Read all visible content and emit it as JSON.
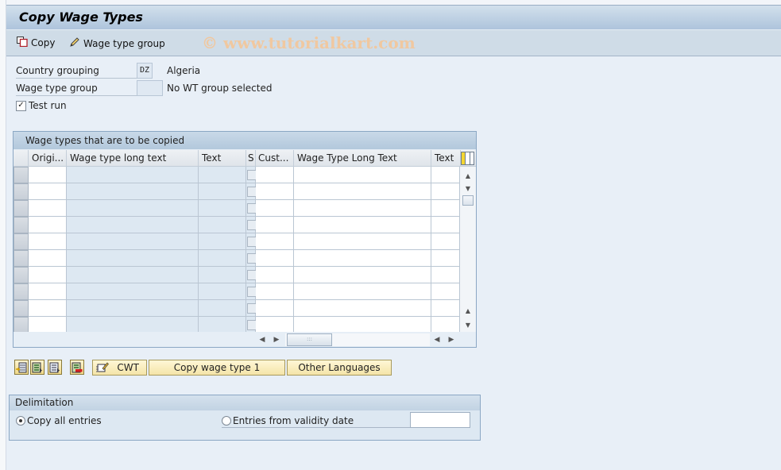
{
  "window": {
    "title": "Copy Wage Types",
    "watermark": "© www.tutorialkart.com"
  },
  "toolbar": {
    "items": [
      {
        "label": "Copy",
        "icon": "copy-icon"
      },
      {
        "label": "Wage type group",
        "icon": "pencil-icon"
      }
    ]
  },
  "selection": {
    "country_grouping": {
      "label": "Country grouping",
      "value": "DZ",
      "description": "Algeria"
    },
    "wage_type_group": {
      "label": "Wage type group",
      "value": "",
      "description": "No WT group selected"
    },
    "test_run": {
      "label": "Test run",
      "checked": true,
      "check_glyph": "✓"
    }
  },
  "grid": {
    "title": "Wage types that are to be copied",
    "columns": [
      {
        "label": "Origi...",
        "style": "white"
      },
      {
        "label": "Wage type long text",
        "style": "blue"
      },
      {
        "label": "Text",
        "style": "blue"
      },
      {
        "label": "S",
        "style": "checkbox"
      },
      {
        "label": "Cust...",
        "style": "white"
      },
      {
        "label": "Wage Type Long Text",
        "style": "white"
      },
      {
        "label": "Text",
        "style": "white"
      }
    ],
    "row_count": 10,
    "rows": [],
    "scroll": {
      "up": "▲",
      "down": "▼",
      "left": "◀",
      "right": "▶",
      "grip": ":::"
    }
  },
  "actions": {
    "icon_buttons": [
      {
        "name": "insert-row-button",
        "icon": "insert-row-icon"
      },
      {
        "name": "select-all-button",
        "icon": "select-all-icon"
      },
      {
        "name": "select-block-button",
        "icon": "select-block-icon"
      },
      {
        "name": "delete-row-button",
        "icon": "delete-row-icon"
      }
    ],
    "cwt_label": "CWT",
    "copy_wage_type_label": "Copy wage type 1",
    "other_languages_label": "Other Languages"
  },
  "delimitation": {
    "title": "Delimitation",
    "options": [
      {
        "label": "Copy all entries",
        "selected": true
      },
      {
        "label": "Entries from validity date",
        "selected": false
      }
    ],
    "validity_date": ""
  }
}
